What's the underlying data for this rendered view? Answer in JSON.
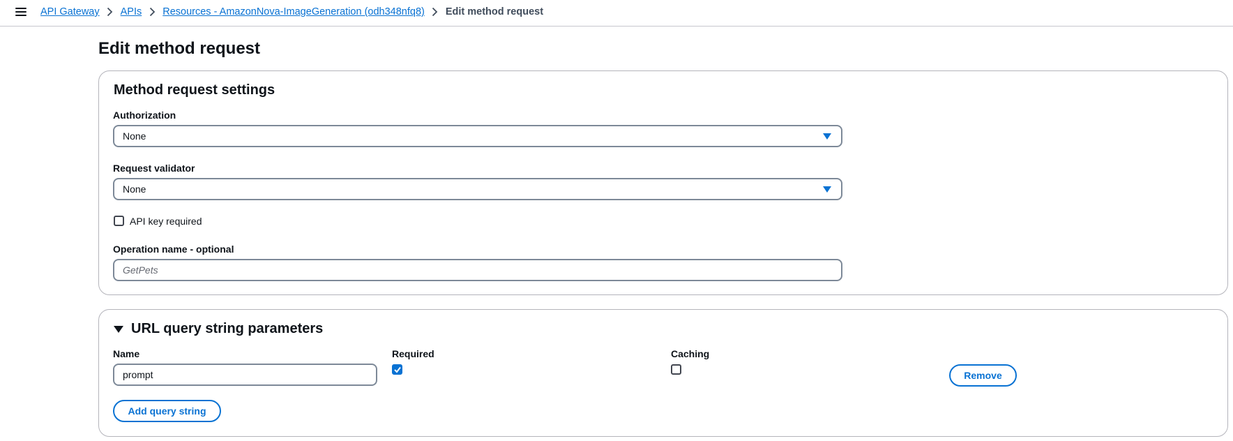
{
  "breadcrumb": {
    "items": [
      "API Gateway",
      "APIs",
      "Resources - AmazonNova-ImageGeneration (odh348nfq8)"
    ],
    "current": "Edit method request"
  },
  "page": {
    "title": "Edit method request"
  },
  "settings": {
    "title": "Method request settings",
    "authorization": {
      "label": "Authorization",
      "value": "None"
    },
    "validator": {
      "label": "Request validator",
      "value": "None"
    },
    "api_key": {
      "label": "API key required",
      "checked": false
    },
    "operation": {
      "label": "Operation name - optional",
      "placeholder": "GetPets"
    }
  },
  "query_params": {
    "title": "URL query string parameters",
    "expanded": true,
    "columns": {
      "name": "Name",
      "required": "Required",
      "caching": "Caching"
    },
    "rows": [
      {
        "name": "prompt",
        "required": true,
        "caching": false,
        "remove_label": "Remove"
      }
    ],
    "add_label": "Add query string"
  },
  "colors": {
    "accent": "#0972d3",
    "border": "#b4b4bb",
    "text": "#0f141a"
  }
}
